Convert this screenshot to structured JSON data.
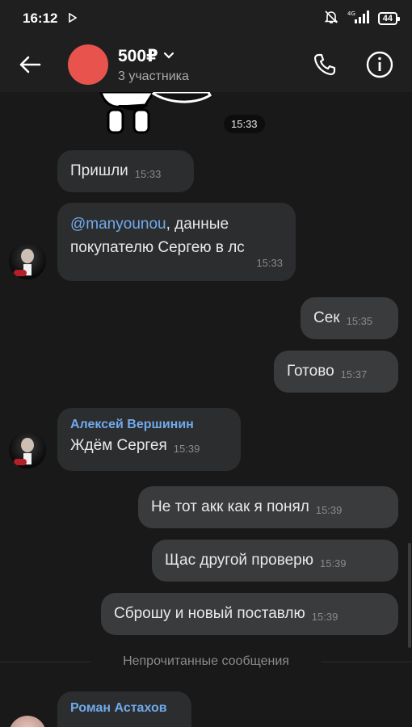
{
  "status_bar": {
    "time": "16:12",
    "media_icon": "play-icon",
    "network": "4G",
    "battery": "44"
  },
  "header": {
    "title": "500₽",
    "subtitle": "3 участника",
    "avatar_color": "#e8534e"
  },
  "sticker": {
    "time": "15:33"
  },
  "messages": [
    {
      "direction": "in",
      "text": "Пришли",
      "time": "15:33"
    },
    {
      "direction": "in",
      "mention": "@manyounou",
      "text_line1": ", данные",
      "text_line2": "покупателю Сергею в лс",
      "time": "15:33"
    },
    {
      "direction": "out",
      "text": "Сек",
      "time": "15:35"
    },
    {
      "direction": "out",
      "text": "Готово",
      "time": "15:37"
    },
    {
      "direction": "in",
      "sender": "Алексей Вершинин",
      "text": "Ждём Сергея",
      "time": "15:39"
    },
    {
      "direction": "out",
      "text": "Не тот акк как я понял",
      "time": "15:39"
    },
    {
      "direction": "out",
      "text": "Щас другой проверю",
      "time": "15:39"
    },
    {
      "direction": "out",
      "text": "Сброшу и новый поставлю",
      "time": "15:39"
    },
    {
      "direction": "in",
      "sender": "Роман Астахов",
      "text": "",
      "time": ""
    }
  ],
  "unread_divider": "Непрочитанные сообщения",
  "colors": {
    "background": "#19191a",
    "bubble_in": "#2c2d2f",
    "bubble_out": "#3a3b3d",
    "accent": "#71aaeb"
  }
}
